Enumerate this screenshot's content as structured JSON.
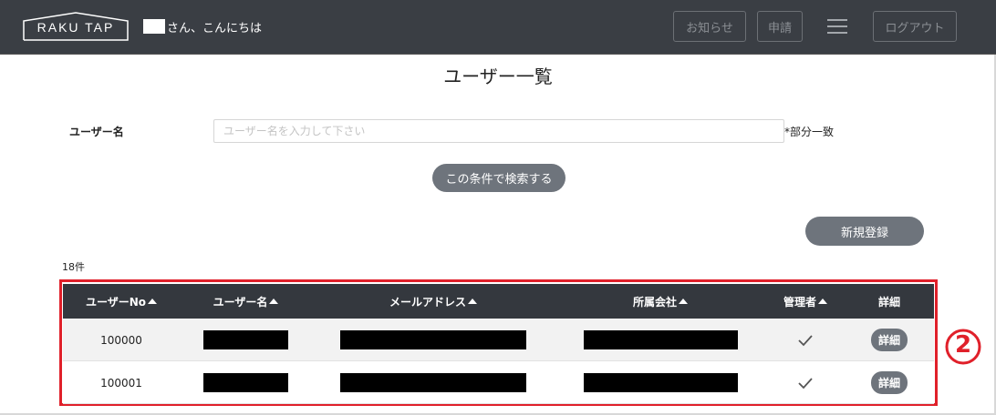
{
  "header": {
    "logo_text": "RAKU TAP",
    "greeting": "さん、こんにちは",
    "notice_label": "お知らせ",
    "apply_label": "申請",
    "logout_label": "ログアウト",
    "menu_icon": "hamburger-menu-icon"
  },
  "page": {
    "title": "ユーザー一覧"
  },
  "search": {
    "label": "ユーザー名",
    "placeholder": "ユーザー名を入力して下さい",
    "value": "",
    "match_note": "*部分一致",
    "button_label": "この条件で検索する"
  },
  "actions": {
    "new_label": "新規登録"
  },
  "results": {
    "count_text": "18件"
  },
  "table": {
    "columns": [
      "ユーザーNo",
      "ユーザー名",
      "メールアドレス",
      "所属会社",
      "管理者",
      "詳細"
    ],
    "rows": [
      {
        "user_no": "100000",
        "admin": true,
        "detail_label": "詳細"
      },
      {
        "user_no": "100001",
        "admin": true,
        "detail_label": "詳細"
      }
    ]
  },
  "annotation": {
    "number": "2"
  },
  "colors": {
    "header_bg": "#3a3e44",
    "table_header_bg": "#34383e",
    "button_bg": "#6e747c",
    "highlight": "#e0202a"
  }
}
